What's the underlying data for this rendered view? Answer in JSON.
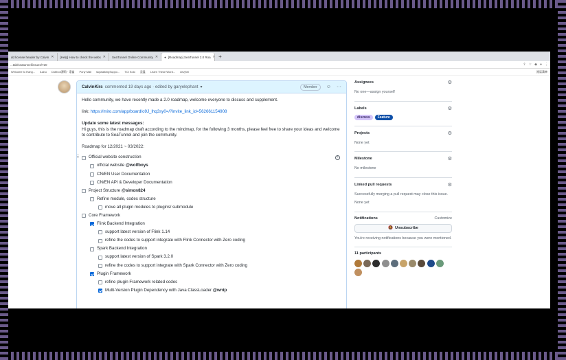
{
  "browser": {
    "tabs": [
      {
        "label": "dd license header by Calvin",
        "active": false
      },
      {
        "label": "[Help] How to check the webs",
        "active": false
      },
      {
        "label": "SeaTunnel Online Community",
        "active": false
      },
      {
        "label": "[Roadmap] SeaTunnel 2.0 Roa",
        "active": true
      }
    ],
    "url": "...tab/seatunnel/issues/720",
    "bookmarks": [
      "Welcome to Hang...",
      "iLabu",
      "Dubbo3源码 · 语雀",
      "Pony Mall",
      "",
      "skywalkingSuppo...",
      "TCI Solo",
      "云盘",
      "Learn These Word...",
      "devjhei"
    ],
    "bookmarks_right": "阅读清单"
  },
  "comment": {
    "author": "CalvinKirs",
    "meta": "commented 19 days ago · edited by garyelephant",
    "member_badge": "Member",
    "intro": "Hello community, we have recently made a 2.0 roadmap, welcome everyone to discuss and supplement.",
    "link_prefix": "link:",
    "link": "https://miro.com/app/board/o9J_lhq3sy0=/?invite_link_id=562661154908",
    "update_title": "Update some latest messages:",
    "update_text": "Hi guys, this is the roadmap draft according to the mindmap, for the following 3 months, please feel free to share your ideas and welcome to contribute to SeaTunnel and join the community.",
    "roadmap_title": "Roadmap for 12/2021 ~ 03/2022:",
    "tasks": [
      {
        "text": "Official website construction",
        "mention": "",
        "level": 0,
        "checked": false
      },
      {
        "text": "official website ",
        "mention": "@wolfboys",
        "level": 1,
        "checked": false
      },
      {
        "text": "CN/EN User Documentation",
        "mention": "",
        "level": 1,
        "checked": false
      },
      {
        "text": "CN/EN API & Developer Documentation",
        "mention": "",
        "level": 1,
        "checked": false
      },
      {
        "text": "Project Structure ",
        "mention": "@simon824",
        "level": 0,
        "checked": false
      },
      {
        "text": "Refine module, codes structure",
        "mention": "",
        "level": 1,
        "checked": false
      },
      {
        "text": "move all plugin modules to plugins/ submodule",
        "mention": "",
        "level": 2,
        "checked": false
      },
      {
        "text": "Core Framework",
        "mention": "",
        "level": 0,
        "checked": false
      },
      {
        "text": "Flink Backend Integration",
        "mention": "",
        "level": 1,
        "checked": true
      },
      {
        "text": "support latest version of Flink 1.14",
        "mention": "",
        "level": 2,
        "checked": false
      },
      {
        "text": "refine the codes to support integrate with Flink Connector with Zero coding",
        "mention": "",
        "level": 2,
        "checked": false
      },
      {
        "text": "Spark Backend Integration",
        "mention": "",
        "level": 1,
        "checked": false
      },
      {
        "text": "support latest version of Spark 3.2.0",
        "mention": "",
        "level": 2,
        "checked": false
      },
      {
        "text": "refine the codes to support integrate with Spark Connector with Zero coding",
        "mention": "",
        "level": 2,
        "checked": false
      },
      {
        "text": "Plugin Framework",
        "mention": "",
        "level": 1,
        "checked": true
      },
      {
        "text": "refine plugin Framework related codes",
        "mention": "",
        "level": 2,
        "checked": false
      },
      {
        "text": "Multi-Version Plugin Dependency with Java ClassLoader ",
        "mention": "@wntp",
        "level": 2,
        "checked": true
      }
    ]
  },
  "sidebar": {
    "assignees_title": "Assignees",
    "assignees_text": "No one—assign yourself",
    "labels_title": "Labels",
    "labels": [
      {
        "name": "discuss",
        "color": "#d4c5f9"
      },
      {
        "name": "Feature",
        "color": "#0e4fa8"
      }
    ],
    "projects_title": "Projects",
    "projects_text": "None yet",
    "milestone_title": "Milestone",
    "milestone_text": "No milestone",
    "linked_title": "Linked pull requests",
    "linked_desc": "Successfully merging a pull request may close this issue.",
    "linked_text": "None yet",
    "notifications_title": "Notifications",
    "customize": "Customize",
    "unsubscribe": "Unsubscribe",
    "notifications_text": "You're receiving notifications because you were mentioned.",
    "participants_title": "11 participants",
    "participant_colors": [
      "#b07a3a",
      "#7b6a58",
      "#2d2d2d",
      "#8f8f8f",
      "#5d6e7c",
      "#c8a46a",
      "#9a8a6a",
      "#5a4a3a",
      "#1e4a8a",
      "#6a9a7a",
      "#c09060"
    ]
  }
}
